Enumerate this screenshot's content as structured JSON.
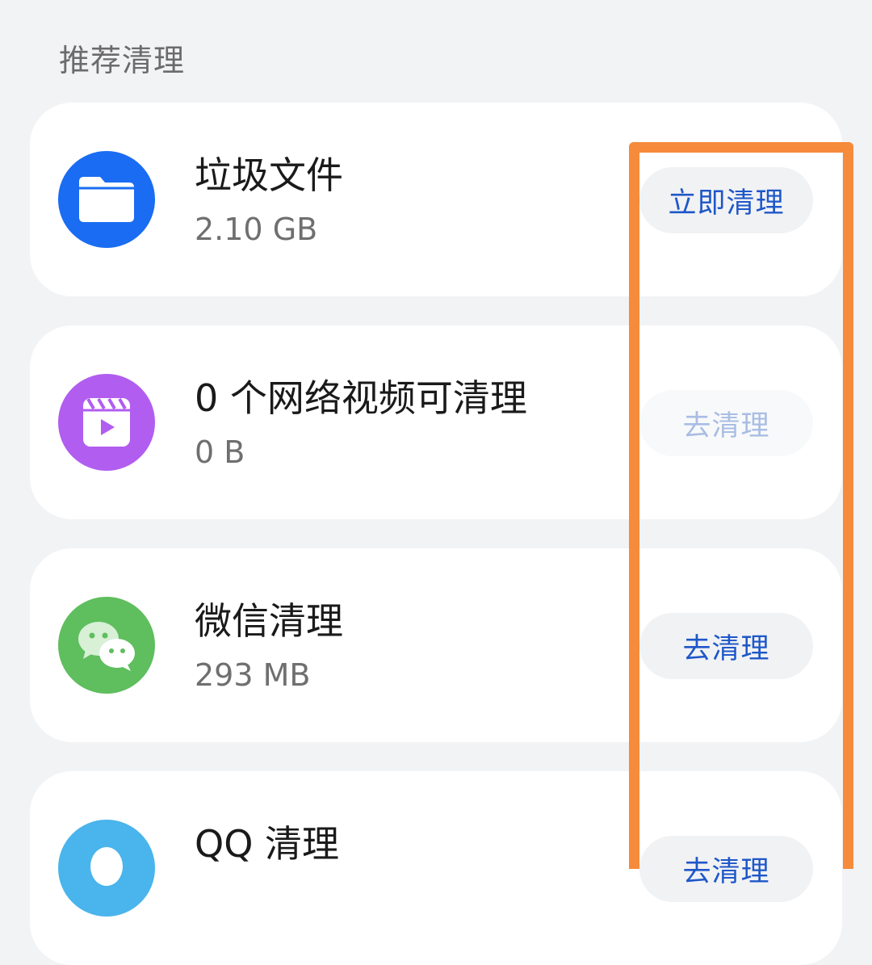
{
  "section": {
    "title": "推荐清理"
  },
  "items": [
    {
      "title": "垃圾文件",
      "size": "2.10 GB",
      "action": "立即清理",
      "icon": "folder-icon",
      "icon_color": "#1a6cf2",
      "enabled": true
    },
    {
      "title": "0 个网络视频可清理",
      "size": "0 B",
      "action": "去清理",
      "icon": "video-icon",
      "icon_color": "#b15df0",
      "enabled": false
    },
    {
      "title": "微信清理",
      "size": "293 MB",
      "action": "去清理",
      "icon": "wechat-icon",
      "icon_color": "#5fbe5e",
      "enabled": true
    },
    {
      "title": "QQ 清理",
      "size": "",
      "action": "去清理",
      "icon": "qq-icon",
      "icon_color": "#4ab4ec",
      "enabled": true
    }
  ],
  "colors": {
    "background": "#f2f3f5",
    "card": "#ffffff",
    "button_text": "#1e57c8",
    "button_text_disabled": "#a9bde4",
    "highlight": "#f58b3b"
  }
}
